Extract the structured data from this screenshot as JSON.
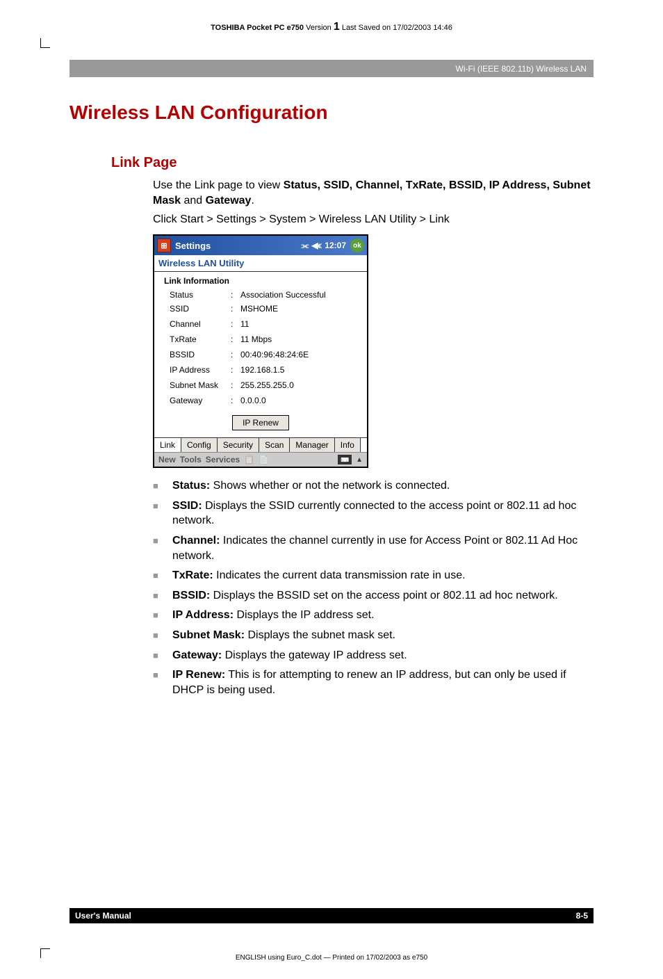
{
  "header": {
    "prefix": "TOSHIBA Pocket PC e750",
    "version_label": " Version ",
    "version_number": "1",
    "saved": " Last Saved on 17/02/2003 14:46"
  },
  "breadcrumb": "Wi-Fi (IEEE 802.11b) Wireless LAN",
  "main_heading": "Wireless LAN Configuration",
  "sub_heading": "Link Page",
  "intro": {
    "prefix": "Use the Link page to view ",
    "bold": "Status, SSID, Channel, TxRate, BSSID, IP Address, Subnet Mask",
    "mid": " and ",
    "bold2": "Gateway",
    "suffix": "."
  },
  "nav_path": "Click Start > Settings > System > Wireless LAN Utility > Link",
  "screenshot": {
    "title_bar": {
      "app": "Settings",
      "time": "12:07",
      "ok": "ok",
      "signal": "📶",
      "sound": "◀ϵ"
    },
    "app_title": "Wireless LAN Utility",
    "section_title": "Link Information",
    "rows": [
      {
        "label": "Status",
        "value": "Association Successful"
      },
      {
        "label": "SSID",
        "value": "MSHOME"
      },
      {
        "label": "Channel",
        "value": "11"
      },
      {
        "label": "TxRate",
        "value": "11 Mbps"
      },
      {
        "label": "BSSID",
        "value": "00:40:96:48:24:6E"
      },
      {
        "label": "IP Address",
        "value": "192.168.1.5"
      },
      {
        "label": "Subnet Mask",
        "value": "255.255.255.0"
      },
      {
        "label": "Gateway",
        "value": "0.0.0.0"
      }
    ],
    "ip_renew": "IP Renew",
    "tabs": [
      "Link",
      "Config",
      "Security",
      "Scan",
      "Manager",
      "Info"
    ],
    "bottom_menu": [
      "New",
      "Tools",
      "Services"
    ]
  },
  "bullets": [
    {
      "term": "Status:",
      "desc": " Shows whether or not the network is connected."
    },
    {
      "term": "SSID:",
      "desc": " Displays the SSID currently connected to the access point or 802.11 ad hoc network."
    },
    {
      "term": "Channel:",
      "desc": " Indicates the channel currently in use for Access Point or 802.11 Ad Hoc network."
    },
    {
      "term": "TxRate:",
      "desc": " Indicates the current data transmission rate in use."
    },
    {
      "term": "BSSID:",
      "desc": " Displays the BSSID set on the access point or 802.11 ad hoc network."
    },
    {
      "term": "IP Address:",
      "desc": " Displays the IP address set."
    },
    {
      "term": "Subnet Mask:",
      "desc": " Displays the subnet mask set."
    },
    {
      "term": "Gateway:",
      "desc": " Displays the gateway IP address set."
    },
    {
      "term": "IP Renew:",
      "desc": " This is for attempting to renew an IP address, but can only be used if DHCP is being used."
    }
  ],
  "footer": {
    "left": "User's Manual",
    "right": "8-5"
  },
  "page_footer": "ENGLISH using Euro_C.dot — Printed on 17/02/2003 as e750"
}
